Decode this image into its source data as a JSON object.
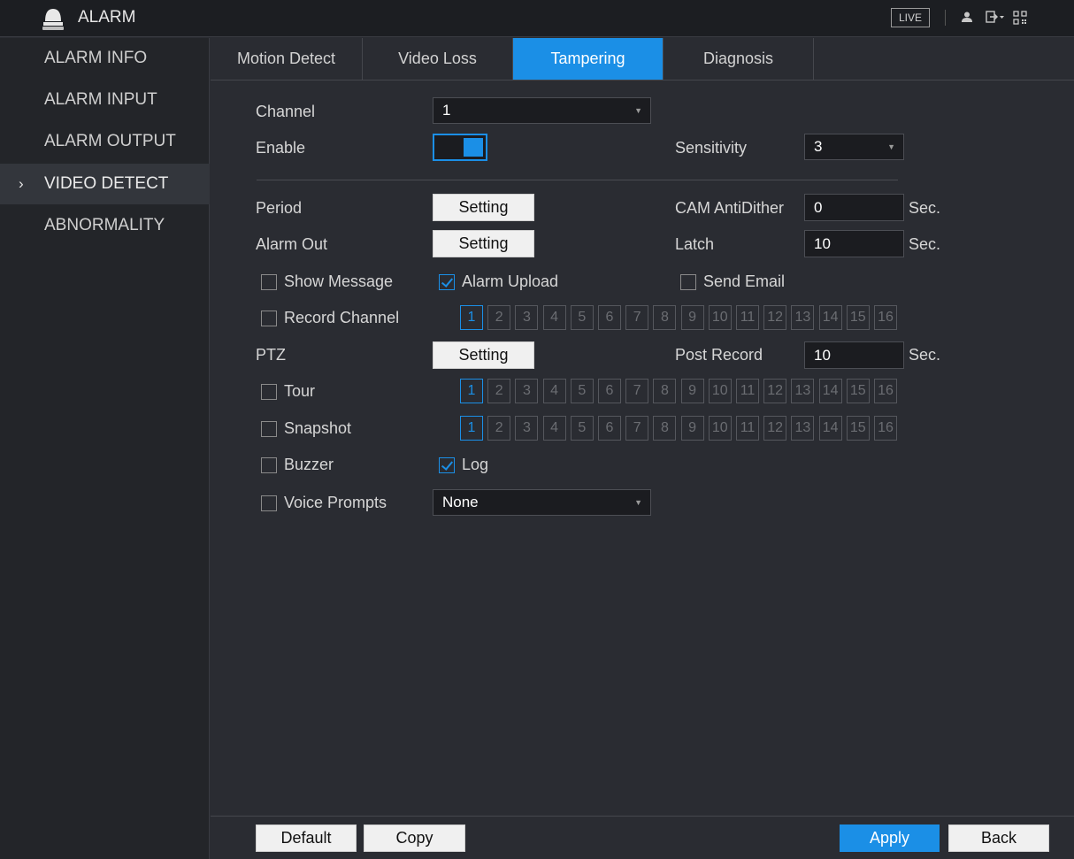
{
  "header": {
    "title": "ALARM",
    "live_label": "LIVE",
    "icons": [
      "user-icon",
      "logout-icon",
      "qr-code-icon"
    ]
  },
  "sidebar": {
    "items": [
      {
        "label": "ALARM INFO"
      },
      {
        "label": "ALARM INPUT"
      },
      {
        "label": "ALARM OUTPUT"
      },
      {
        "label": "VIDEO DETECT",
        "active": true
      },
      {
        "label": "ABNORMALITY"
      }
    ],
    "active_chevron": "›"
  },
  "tabs": [
    {
      "label": "Motion Detect"
    },
    {
      "label": "Video Loss"
    },
    {
      "label": "Tampering",
      "active": true
    },
    {
      "label": "Diagnosis"
    }
  ],
  "form": {
    "channel_label": "Channel",
    "channel_value": "1",
    "enable_label": "Enable",
    "enable_on": true,
    "sensitivity_label": "Sensitivity",
    "sensitivity_value": "3",
    "period_label": "Period",
    "period_button": "Setting",
    "cam_antidither_label": "CAM AntiDither",
    "cam_antidither_value": "0",
    "cam_antidither_unit": "Sec.",
    "alarm_out_label": "Alarm Out",
    "alarm_out_button": "Setting",
    "latch_label": "Latch",
    "latch_value": "10",
    "latch_unit": "Sec.",
    "show_message_label": "Show Message",
    "show_message_checked": false,
    "alarm_upload_label": "Alarm Upload",
    "alarm_upload_checked": true,
    "send_email_label": "Send Email",
    "send_email_checked": false,
    "record_channel_label": "Record Channel",
    "record_channel_checked": false,
    "ptz_label": "PTZ",
    "ptz_button": "Setting",
    "post_record_label": "Post Record",
    "post_record_value": "10",
    "post_record_unit": "Sec.",
    "tour_label": "Tour",
    "tour_checked": false,
    "snapshot_label": "Snapshot",
    "snapshot_checked": false,
    "buzzer_label": "Buzzer",
    "buzzer_checked": false,
    "log_label": "Log",
    "log_checked": true,
    "voice_prompts_label": "Voice Prompts",
    "voice_prompts_checked": false,
    "voice_prompts_value": "None",
    "channels": [
      "1",
      "2",
      "3",
      "4",
      "5",
      "6",
      "7",
      "8",
      "9",
      "10",
      "11",
      "12",
      "13",
      "14",
      "15",
      "16"
    ],
    "selected_channel": "1"
  },
  "footer": {
    "default_label": "Default",
    "copy_label": "Copy",
    "apply_label": "Apply",
    "back_label": "Back"
  },
  "colors": {
    "accent": "#1b8fe6",
    "background": "#2a2c32",
    "sidebar": "#232529",
    "topbar": "#1c1e22"
  }
}
